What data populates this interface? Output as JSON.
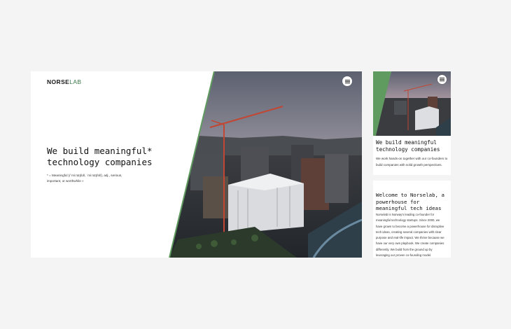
{
  "desktop": {
    "logo_norse": "NORSE",
    "logo_lab": "LAB",
    "headline_line1": "We build meaningful*",
    "headline_line2": "technology companies",
    "footnote": "* = Meaningful (/ˈmiːnɪŋfʊl/, ˈmiːnɪŋfəl/), adj., serious, important, or worthwhile »",
    "menu_icon": "hamburger-menu-icon"
  },
  "mobile_hero": {
    "headline": "We build meaningful technology companies",
    "text": "We work hands-on together with our co-founders to build companies with solid growth perspectives.",
    "menu_icon": "hamburger-menu-icon"
  },
  "mobile_about": {
    "headline": "Welcome to Norselab, a powerhouse for meaningful tech ideas",
    "text": "Norselab is Norway's leading co-founder for meaningful technology startups. Since 2000, we have grown to become a powerhouse for disruptive tech ideas, creating several companies with clear purpose and real-life impact. We thrive because we have our very own playbook. We create companies differently. We build from the ground up by leveraging our proven co-founding model."
  },
  "colors": {
    "brand_green": "#3d7a4a",
    "light_green": "#5f9a5f",
    "page_bg": "#f4f4f4"
  }
}
